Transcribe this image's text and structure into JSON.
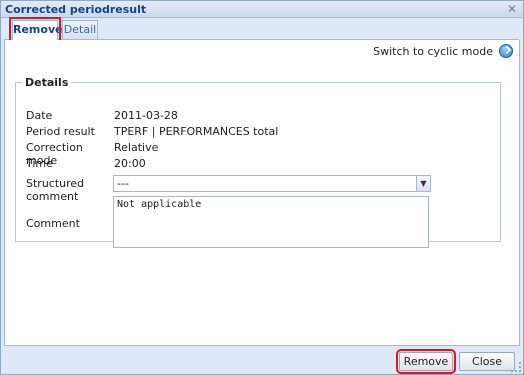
{
  "window": {
    "title": "Corrected periodresult"
  },
  "tabs": [
    {
      "label": "Remove",
      "active": true
    },
    {
      "label": "Detail",
      "active": false
    }
  ],
  "switch_mode": {
    "label": "Switch to cyclic mode",
    "icon": "circular-arrow-icon"
  },
  "details": {
    "legend": "Details",
    "fields": [
      {
        "label": "Date",
        "value": "2011-03-28"
      },
      {
        "label": "Period result",
        "value": "TPERF | PERFORMANCES total"
      },
      {
        "label": "Correction mode",
        "value": "Relative"
      },
      {
        "label": "Time",
        "value": "20:00"
      }
    ],
    "structured_comment": {
      "label": "Structured comment",
      "value": "---"
    },
    "comment": {
      "label": "Comment",
      "value": "Not applicable"
    }
  },
  "buttons": {
    "remove": "Remove",
    "close": "Close"
  },
  "colors": {
    "highlight": "#e0151d",
    "accent": "#15428b",
    "border": "#99bbe8"
  }
}
